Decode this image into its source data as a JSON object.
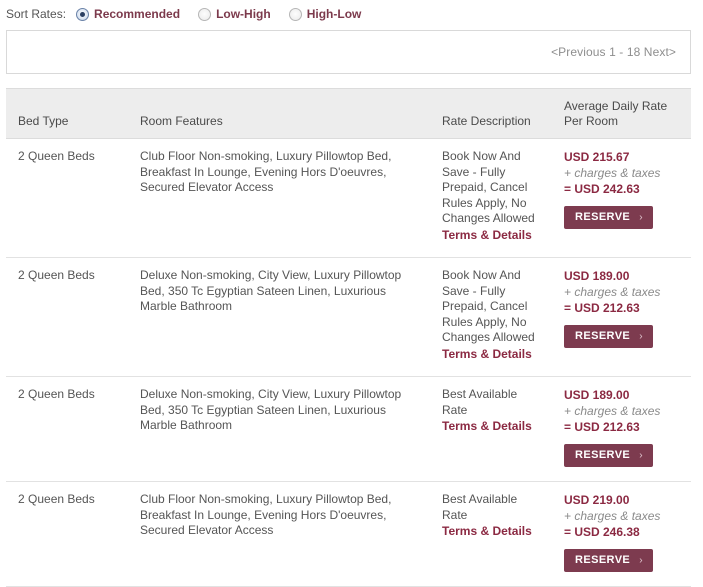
{
  "sort": {
    "label": "Sort Rates:",
    "options": [
      {
        "label": "Recommended",
        "selected": true
      },
      {
        "label": "Low-High",
        "selected": false
      },
      {
        "label": "High-Low",
        "selected": false
      }
    ]
  },
  "pager": {
    "text": "<Previous 1 - 18 Next>"
  },
  "table": {
    "headers": {
      "bed_type": "Bed Type",
      "room_features": "Room Features",
      "rate_description": "Rate Description",
      "average_daily_rate": "Average Daily Rate Per Room"
    },
    "rows": [
      {
        "bed_type": "2 Queen Beds",
        "room_features": "Club Floor Non-smoking, Luxury Pillowtop Bed, Breakfast In Lounge, Evening Hors D'oeuvres, Secured Elevator Access",
        "rate_description": "Book Now And Save - Fully Prepaid, Cancel Rules Apply, No Changes Allowed",
        "terms_link": "Terms & Details",
        "price": "USD 215.67",
        "charges": "+ charges & taxes",
        "total": "= USD 242.63",
        "reserve_label": "RESERVE"
      },
      {
        "bed_type": "2 Queen Beds",
        "room_features": "Deluxe Non-smoking, City View, Luxury Pillowtop Bed, 350 Tc Egyptian Sateen Linen, Luxurious Marble Bathroom",
        "rate_description": "Book Now And Save - Fully Prepaid, Cancel Rules Apply, No Changes Allowed",
        "terms_link": "Terms & Details",
        "price": "USD 189.00",
        "charges": "+ charges & taxes",
        "total": "= USD 212.63",
        "reserve_label": "RESERVE"
      },
      {
        "bed_type": "2 Queen Beds",
        "room_features": "Deluxe Non-smoking, City View, Luxury Pillowtop Bed, 350 Tc Egyptian Sateen Linen, Luxurious Marble Bathroom",
        "rate_description": "Best Available Rate",
        "terms_link": "Terms & Details",
        "price": "USD 189.00",
        "charges": "+ charges & taxes",
        "total": "= USD 212.63",
        "reserve_label": "RESERVE"
      },
      {
        "bed_type": "2 Queen Beds",
        "room_features": "Club Floor Non-smoking, Luxury Pillowtop Bed, Breakfast In Lounge, Evening Hors D'oeuvres, Secured Elevator Access",
        "rate_description": "Best Available Rate",
        "terms_link": "Terms & Details",
        "price": "USD 219.00",
        "charges": "+ charges & taxes",
        "total": "= USD 246.38",
        "reserve_label": "RESERVE"
      }
    ]
  },
  "colors": {
    "accent": "#8b2942",
    "button": "#7d3b4f",
    "header_bg": "#ededed",
    "text": "#555555"
  }
}
